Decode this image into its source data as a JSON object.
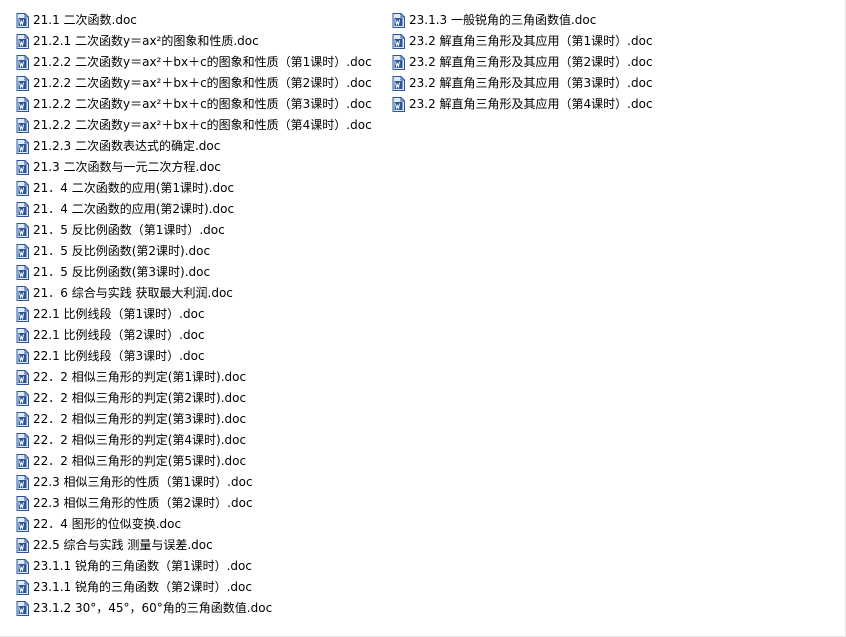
{
  "icon": "word-doc-icon",
  "colors": {
    "icon_blue": "#2b579a",
    "icon_light": "#dfe9f7"
  },
  "files": {
    "column1": [
      "21.1  二次函数.doc",
      "21.2.1 二次函数y＝ax²的图象和性质.doc",
      "21.2.2    二次函数y＝ax²＋bx＋c的图象和性质（第1课时）.doc",
      "21.2.2    二次函数y＝ax²＋bx＋c的图象和性质（第2课时）.doc",
      "21.2.2    二次函数y＝ax²＋bx＋c的图象和性质（第3课时）.doc",
      "21.2.2    二次函数y＝ax²＋bx＋c的图象和性质（第4课时）.doc",
      "21.2.3    二次函数表达式的确定.doc",
      "21.3    二次函数与一元二次方程.doc",
      "21．4    二次函数的应用(第1课时).doc",
      "21．4    二次函数的应用(第2课时).doc",
      "21．5    反比例函数（第1课时）.doc",
      "21．5    反比例函数(第2课时).doc",
      "21．5    反比例函数(第3课时).doc",
      "21．6    综合与实践    获取最大利润.doc",
      "22.1    比例线段（第1课时）.doc",
      "22.1    比例线段（第2课时）.doc",
      "22.1    比例线段（第3课时）.doc",
      "22．2    相似三角形的判定(第1课时).doc",
      "22．2    相似三角形的判定(第2课时).doc",
      "22．2    相似三角形的判定(第3课时).doc",
      "22．2    相似三角形的判定(第4课时).doc",
      "22．2    相似三角形的判定(第5课时).doc",
      "22.3    相似三角形的性质（第1课时）.doc",
      "22.3    相似三角形的性质（第2课时）.doc",
      "22．4    图形的位似变换.doc",
      "22.5    综合与实践    测量与误差.doc",
      "23.1.1  锐角的三角函数（第1课时）.doc",
      "23.1.1  锐角的三角函数（第2课时）.doc",
      "23.1.2    30°，45°，60°角的三角函数值.doc"
    ],
    "column2": [
      "23.1.3    一般锐角的三角函数值.doc",
      "23.2  解直角三角形及其应用（第1课时）.doc",
      "23.2  解直角三角形及其应用（第2课时）.doc",
      "23.2  解直角三角形及其应用（第3课时）.doc",
      "23.2  解直角三角形及其应用（第4课时）.doc"
    ]
  }
}
